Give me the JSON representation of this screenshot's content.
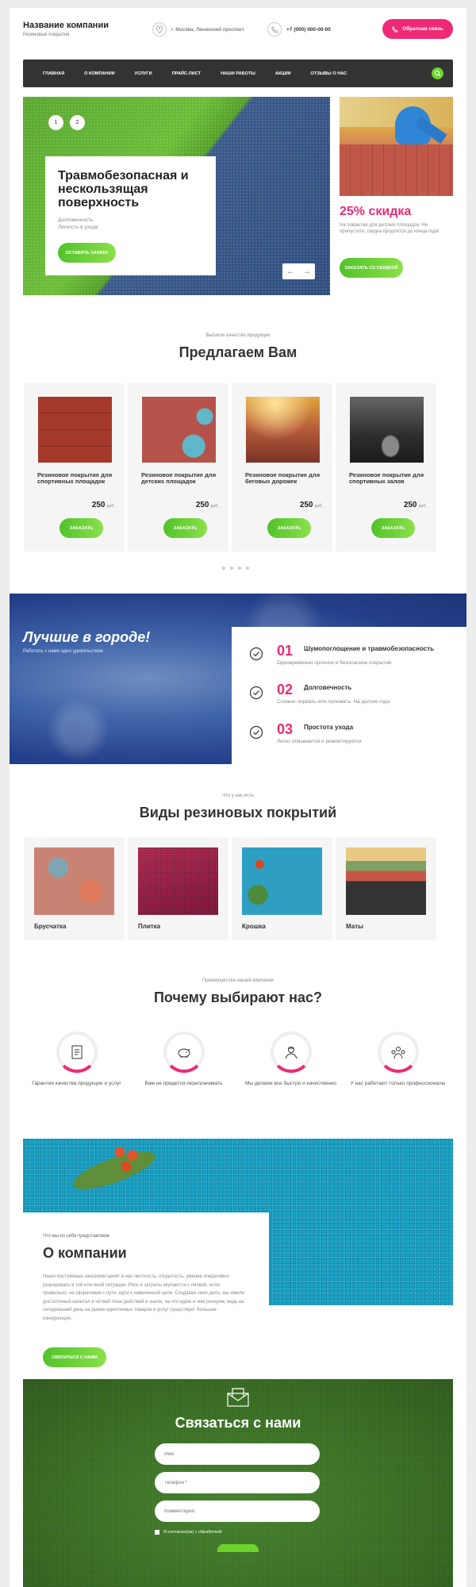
{
  "header": {
    "company_name": "Название компании",
    "company_sub": "Резиновые покрытия",
    "address": "г. Москва, Ленинский проспект",
    "phone": "+7 (000) 000-00-00",
    "callback_label": "Обратная связь"
  },
  "nav": {
    "items": [
      "ГЛАВНАЯ",
      "О КОМПАНИИ",
      "УСЛУГИ",
      "ПРАЙС-ЛИСТ",
      "НАШИ РАБОТЫ",
      "АКЦИИ",
      "ОТЗЫВЫ О НАС"
    ]
  },
  "hero": {
    "slide_numbers": [
      "1",
      "2"
    ],
    "title": "Травмобезопасная и нескользящая поверхность",
    "line1": "Долговечность",
    "line2": "Легкость в уходе",
    "button": "ОСТАВИТЬ ЗАЯВКУ"
  },
  "promo": {
    "discount": "25% скидка",
    "text": "На покрытие для детских площадок. Не пропустите, скидка продлится до конца года!",
    "button": "ЗАКАЗАТЬ СО СКИДКОЙ"
  },
  "offer": {
    "small": "Высокое качество продукции",
    "title": "Предлагаем Вам",
    "currency": "руб.",
    "order_label": "ЗАКАЗАТЬ",
    "products": [
      {
        "title": "Резиновое покрытие для спортивных площадок",
        "price": "250"
      },
      {
        "title": "Резиновое покрытие для детских площадок",
        "price": "250"
      },
      {
        "title": "Резиновое покрытие для беговых дорожек",
        "price": "250"
      },
      {
        "title": "Резиновое покрытие для спортивных залов",
        "price": "250"
      }
    ]
  },
  "best": {
    "title": "Лучшие в городе!",
    "sub": "Работать с нами одно удовольствие",
    "items": [
      {
        "num": "01",
        "title": "Шумопоглощение и травмобезопасность",
        "desc": "Одновременно прочное и безопасное покрытие"
      },
      {
        "num": "02",
        "title": "Долговечность",
        "desc": "Сложно порвать или поломать. На долгие года"
      },
      {
        "num": "03",
        "title": "Простота ухода",
        "desc": "Легко отмывается и ремонтируется"
      }
    ]
  },
  "types": {
    "small": "Что у нас есть",
    "title": "Виды резиновых покрытий",
    "items": [
      "Брусчатка",
      "Плитка",
      "Крошка",
      "Маты"
    ]
  },
  "why": {
    "small": "Преимущества нашей компании",
    "title": "Почему выбирают нас?",
    "items": [
      {
        "text": "Гарантия качества продукции и услуг",
        "icon": "document-icon"
      },
      {
        "text": "Вам не придется переплачивать",
        "icon": "piggy-bank-icon"
      },
      {
        "text": "Мы делаем все быстро и качественно",
        "icon": "worker-icon"
      },
      {
        "text": "У нас работают только профессионалы",
        "icon": "team-icon"
      }
    ]
  },
  "about": {
    "small": "Что мы из себя представляем",
    "title": "О компании",
    "text": "Наши постоянные заказчики ценят в нас честность, открытость, умение оперативно реагировать в той или иной ситуации. Риск и затраты окупаются с лихвой, если правильно, не сворачивая с пути, идти к намеченной цели. Создавая свое дело, мы имели достаточный капитал и чёткий план действий и знали, на что идём и чем рискуем, ведь на сегодняшний день на рынке идентичных товаров и услуг существует большая конкуренция.",
    "button": "СВЯЗАТЬСЯ С НАМИ"
  },
  "contact": {
    "title": "Связаться с нами",
    "name_placeholder": "Имя:",
    "phone_placeholder": "Телефон *",
    "comment_placeholder": "Комментарий:",
    "consent": "Я согласен(на) с обработкой"
  },
  "colors": {
    "accent": "#ee2a75",
    "green": "#6cd32c",
    "dark": "#333333"
  }
}
